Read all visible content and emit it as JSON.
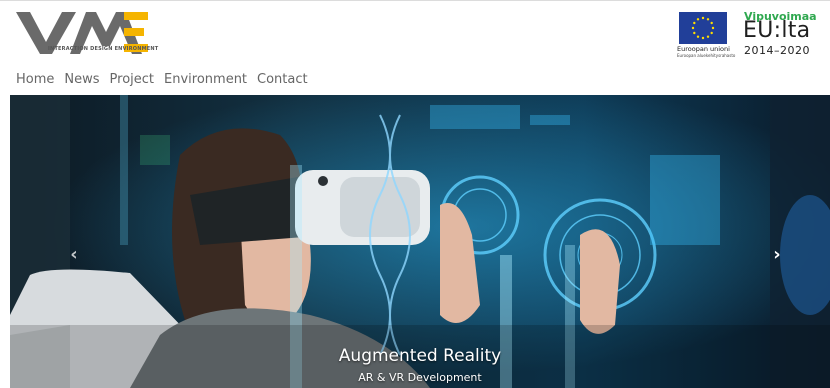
{
  "brand": {
    "logo_text": "VME",
    "logo_subtitle": "INTERACTION DESIGN ENVIRONMENT"
  },
  "sponsors": {
    "eu_caption": "Euroopan unioni",
    "eu_subcaption": "Euroopan aluekehitysrahasto",
    "program_title": "Vipuvoimaa",
    "program_name": "EU:lta",
    "program_years": "2014–2020"
  },
  "nav": {
    "items": [
      {
        "label": "Home"
      },
      {
        "label": "News"
      },
      {
        "label": "Project"
      },
      {
        "label": "Environment"
      },
      {
        "label": "Contact"
      }
    ]
  },
  "carousel": {
    "slide_title": "Augmented Reality",
    "slide_subtitle": "AR & VR Development",
    "prev_icon": "chevron-left-icon",
    "next_icon": "chevron-right-icon"
  },
  "colors": {
    "logo_grey": "#6a6a6a",
    "logo_yellow": "#f5b400",
    "eu_blue": "#213f99",
    "eu_star": "#ffdd00",
    "vipu_green": "#2fa84f",
    "nav_text": "#666666"
  }
}
